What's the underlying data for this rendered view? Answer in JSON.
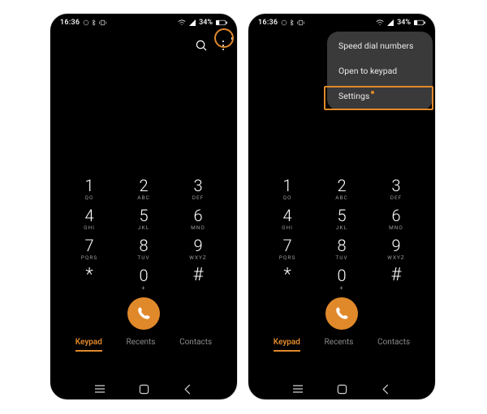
{
  "status": {
    "time": "16:36",
    "battery": "34%",
    "wifi": "wifi-icon",
    "signal": "signal-icon"
  },
  "header": {
    "search": "search-icon",
    "more": "more-icon"
  },
  "menu": {
    "items": [
      {
        "label": "Speed dial numbers"
      },
      {
        "label": "Open to keypad"
      },
      {
        "label": "Settings"
      }
    ]
  },
  "keypad": {
    "rows": [
      [
        {
          "d": "1",
          "l": "QO"
        },
        {
          "d": "2",
          "l": "ABC"
        },
        {
          "d": "3",
          "l": "DEF"
        }
      ],
      [
        {
          "d": "4",
          "l": "GHI"
        },
        {
          "d": "5",
          "l": "JKL"
        },
        {
          "d": "6",
          "l": "MNO"
        }
      ],
      [
        {
          "d": "7",
          "l": "PQRS"
        },
        {
          "d": "8",
          "l": "TUV"
        },
        {
          "d": "9",
          "l": "WXYZ"
        }
      ],
      [
        {
          "d": "*",
          "l": ""
        },
        {
          "d": "0",
          "l": "+"
        },
        {
          "d": "#",
          "l": ""
        }
      ]
    ]
  },
  "tabs": {
    "keypad": "Keypad",
    "recents": "Recents",
    "contacts": "Contacts"
  },
  "nav": {
    "recents": "recents-btn",
    "home": "home-btn",
    "back": "back-btn"
  }
}
